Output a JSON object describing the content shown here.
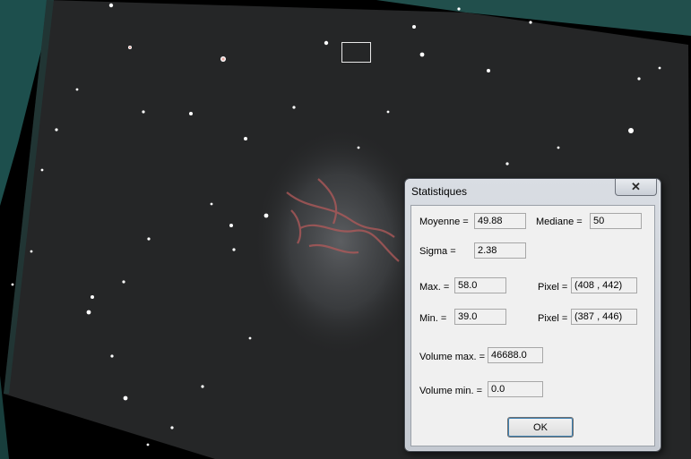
{
  "window": {
    "title": "Statistiques",
    "close_glyph": "✕"
  },
  "stats": {
    "moyenne_label": "Moyenne =",
    "moyenne_value": "49.88",
    "mediane_label": "Mediane =",
    "mediane_value": "50",
    "sigma_label": "Sigma =",
    "sigma_value": "2.38",
    "max_label": "Max. =",
    "max_value": "58.0",
    "max_pixel_label": "Pixel =",
    "max_pixel_value": "(408 , 442)",
    "min_label": "Min. =",
    "min_value": "39.0",
    "min_pixel_label": "Pixel =",
    "min_pixel_value": "(387 , 446)",
    "volume_max_label": "Volume max. =",
    "volume_max_value": "46688.0",
    "volume_min_label": "Volume min. =",
    "volume_min_value": "0.0"
  },
  "buttons": {
    "ok_label": "OK"
  },
  "colors": {
    "nebula_red": "#b35a5a",
    "sky": "#242526",
    "corner_cyan": "#2a6e6a"
  }
}
